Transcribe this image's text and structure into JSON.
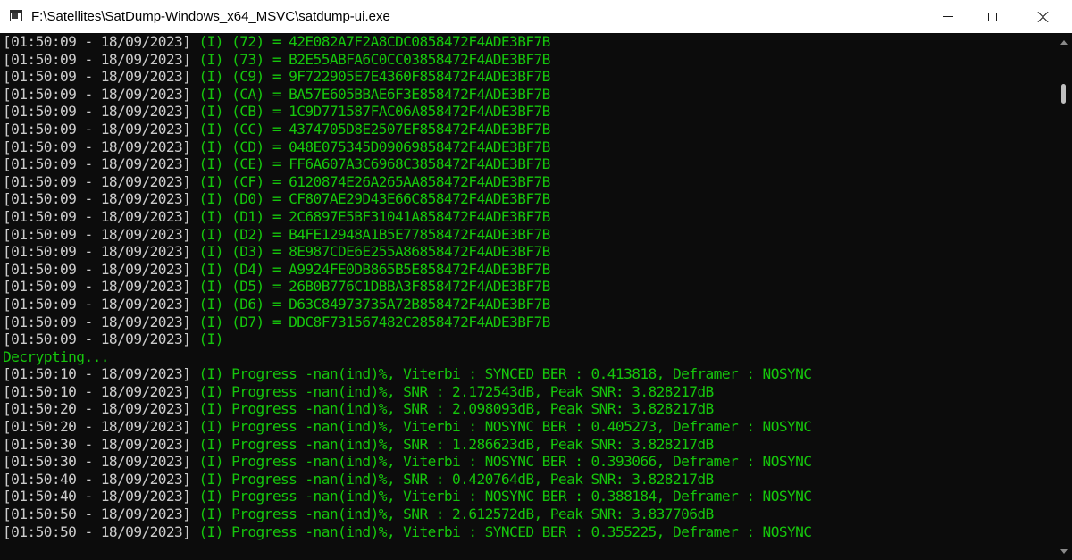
{
  "window": {
    "title": "F:\\Satellites\\SatDump-Windows_x64_MSVC\\satdump-ui.exe",
    "icon": "console-window-icon",
    "controls": {
      "minimize": "minimize-icon",
      "maximize": "maximize-icon",
      "close": "close-icon"
    }
  },
  "colors": {
    "background": "#0c0c0c",
    "timestamp": "#cccccc",
    "log_green": "#16c60c",
    "titlebar": "#ffffff"
  },
  "console": {
    "lines": [
      {
        "ts": "[01:50:09 - 18/09/2023]",
        "msg": " (I) (72) = 42E082A7F2A8CDC0858472F4ADE3BF7B"
      },
      {
        "ts": "[01:50:09 - 18/09/2023]",
        "msg": " (I) (73) = B2E55ABFA6C0CC03858472F4ADE3BF7B"
      },
      {
        "ts": "[01:50:09 - 18/09/2023]",
        "msg": " (I) (C9) = 9F722905E7E4360F858472F4ADE3BF7B"
      },
      {
        "ts": "[01:50:09 - 18/09/2023]",
        "msg": " (I) (CA) = BA57E605BBAE6F3E858472F4ADE3BF7B"
      },
      {
        "ts": "[01:50:09 - 18/09/2023]",
        "msg": " (I) (CB) = 1C9D771587FAC06A858472F4ADE3BF7B"
      },
      {
        "ts": "[01:50:09 - 18/09/2023]",
        "msg": " (I) (CC) = 4374705D8E2507EF858472F4ADE3BF7B"
      },
      {
        "ts": "[01:50:09 - 18/09/2023]",
        "msg": " (I) (CD) = 048E075345D09069858472F4ADE3BF7B"
      },
      {
        "ts": "[01:50:09 - 18/09/2023]",
        "msg": " (I) (CE) = FF6A607A3C6968C3858472F4ADE3BF7B"
      },
      {
        "ts": "[01:50:09 - 18/09/2023]",
        "msg": " (I) (CF) = 6120874E26A265AA858472F4ADE3BF7B"
      },
      {
        "ts": "[01:50:09 - 18/09/2023]",
        "msg": " (I) (D0) = CF807AE29D43E66C858472F4ADE3BF7B"
      },
      {
        "ts": "[01:50:09 - 18/09/2023]",
        "msg": " (I) (D1) = 2C6897E5BF31041A858472F4ADE3BF7B"
      },
      {
        "ts": "[01:50:09 - 18/09/2023]",
        "msg": " (I) (D2) = B4FE12948A1B5E77858472F4ADE3BF7B"
      },
      {
        "ts": "[01:50:09 - 18/09/2023]",
        "msg": " (I) (D3) = 8E987CDE6E255A86858472F4ADE3BF7B"
      },
      {
        "ts": "[01:50:09 - 18/09/2023]",
        "msg": " (I) (D4) = A9924FE0DB865B5E858472F4ADE3BF7B"
      },
      {
        "ts": "[01:50:09 - 18/09/2023]",
        "msg": " (I) (D5) = 26B0B776C1DBBA3F858472F4ADE3BF7B"
      },
      {
        "ts": "[01:50:09 - 18/09/2023]",
        "msg": " (I) (D6) = D63C84973735A72B858472F4ADE3BF7B"
      },
      {
        "ts": "[01:50:09 - 18/09/2023]",
        "msg": " (I) (D7) = DDC8F731567482C2858472F4ADE3BF7B"
      },
      {
        "ts": "[01:50:09 - 18/09/2023]",
        "msg": " (I)"
      },
      {
        "ts": "",
        "msg": "Decrypting..."
      },
      {
        "ts": "[01:50:10 - 18/09/2023]",
        "msg": " (I) Progress -nan(ind)%, Viterbi : SYNCED BER : 0.413818, Deframer : NOSYNC"
      },
      {
        "ts": "[01:50:10 - 18/09/2023]",
        "msg": " (I) Progress -nan(ind)%, SNR : 2.172543dB, Peak SNR: 3.828217dB"
      },
      {
        "ts": "[01:50:20 - 18/09/2023]",
        "msg": " (I) Progress -nan(ind)%, SNR : 2.098093dB, Peak SNR: 3.828217dB"
      },
      {
        "ts": "[01:50:20 - 18/09/2023]",
        "msg": " (I) Progress -nan(ind)%, Viterbi : NOSYNC BER : 0.405273, Deframer : NOSYNC"
      },
      {
        "ts": "[01:50:30 - 18/09/2023]",
        "msg": " (I) Progress -nan(ind)%, SNR : 1.286623dB, Peak SNR: 3.828217dB"
      },
      {
        "ts": "[01:50:30 - 18/09/2023]",
        "msg": " (I) Progress -nan(ind)%, Viterbi : NOSYNC BER : 0.393066, Deframer : NOSYNC"
      },
      {
        "ts": "[01:50:40 - 18/09/2023]",
        "msg": " (I) Progress -nan(ind)%, SNR : 0.420764dB, Peak SNR: 3.828217dB"
      },
      {
        "ts": "[01:50:40 - 18/09/2023]",
        "msg": " (I) Progress -nan(ind)%, Viterbi : NOSYNC BER : 0.388184, Deframer : NOSYNC"
      },
      {
        "ts": "[01:50:50 - 18/09/2023]",
        "msg": " (I) Progress -nan(ind)%, SNR : 2.612572dB, Peak SNR: 3.837706dB"
      },
      {
        "ts": "[01:50:50 - 18/09/2023]",
        "msg": " (I) Progress -nan(ind)%, Viterbi : SYNCED BER : 0.355225, Deframer : NOSYNC"
      }
    ]
  }
}
